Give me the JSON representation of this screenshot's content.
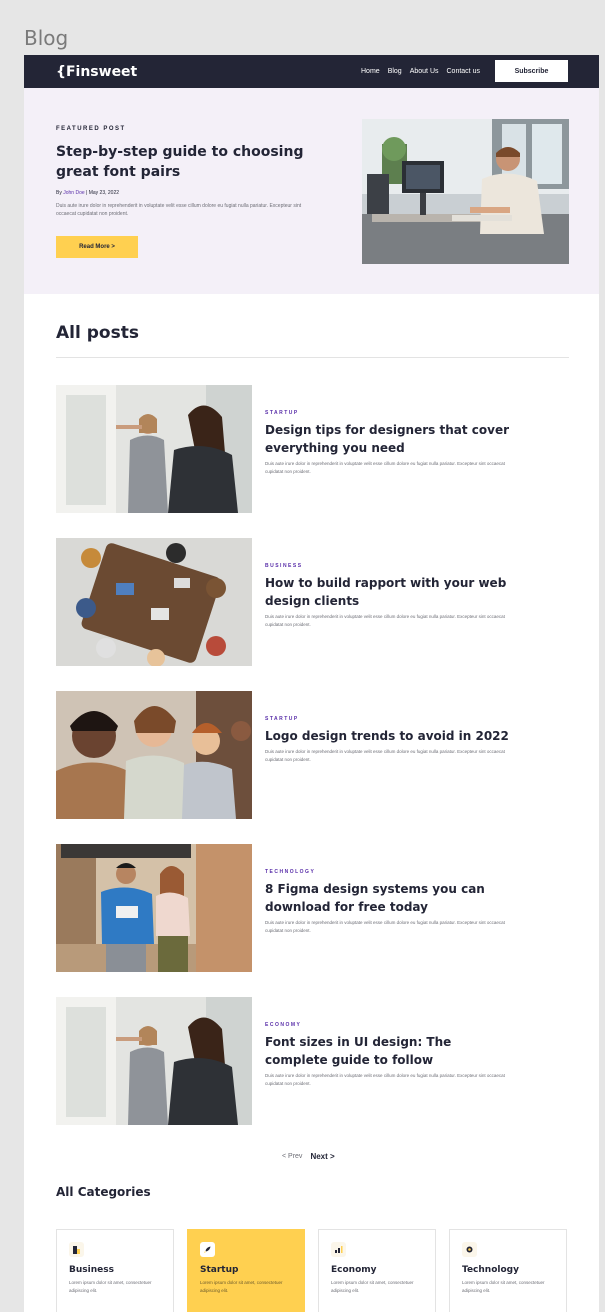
{
  "frame_label": "Blog",
  "nav": {
    "logo": "{Finsweet",
    "links": [
      "Home",
      "Blog",
      "About Us",
      "Contact us"
    ],
    "subscribe_label": "Subscribe"
  },
  "featured": {
    "label": "FEATURED POST",
    "title": "Step-by-step guide to choosing great font pairs",
    "meta_prefix": "By ",
    "author": "John Doe",
    "meta_separator": " | ",
    "date": "May 23, 2022",
    "description": "Duis aute irure dolor in reprehenderit in voluptate velit esse cillum dolore eu fugiat nulla pariatur. Excepteur sint occaecat cupidatat non proident.",
    "button_label": "Read More >"
  },
  "all_posts": {
    "title": "All posts",
    "posts": [
      {
        "category": "STARTUP",
        "title": "Design tips for designers that cover everything you need",
        "description": "Duis aute irure dolor in reprehenderit in voluptate velit esse cillum dolore eu fugiat nulla pariatur. Excepteur sint occaecat cupidatat non proident."
      },
      {
        "category": "BUSINESS",
        "title": "How to build rapport with your web design clients",
        "description": "Duis aute irure dolor in reprehenderit in voluptate velit esse cillum dolore eu fugiat nulla pariatur. Excepteur sint occaecat cupidatat non proident."
      },
      {
        "category": "STARTUP",
        "title": "Logo design trends to avoid in 2022",
        "description": "Duis aute irure dolor in reprehenderit in voluptate velit esse cillum dolore eu fugiat nulla pariatur. Excepteur sint occaecat cupidatat non proident."
      },
      {
        "category": "TECHNOLOGY",
        "title": "8 Figma design systems you can download for free today",
        "description": "Duis aute irure dolor in reprehenderit in voluptate velit esse cillum dolore eu fugiat nulla pariatur. Excepteur sint occaecat cupidatat non proident."
      },
      {
        "category": "ECONOMY",
        "title": "Font sizes in UI design: The complete guide to follow",
        "description": "Duis aute irure dolor in reprehenderit in voluptate velit esse cillum dolore eu fugiat nulla pariatur. Excepteur sint occaecat cupidatat non proident."
      }
    ]
  },
  "pagination": {
    "prev_label": "< Prev",
    "next_label": "Next >"
  },
  "categories": {
    "title": "All Categories",
    "items": [
      {
        "name": "Business",
        "description": "Lorem ipsum dolor sit amet, consectetuer adipiscing elit.",
        "icon": "building-icon"
      },
      {
        "name": "Startup",
        "description": "Lorem ipsum dolor sit amet, consectetuer adipiscing elit.",
        "icon": "rocket-icon"
      },
      {
        "name": "Economy",
        "description": "Lorem ipsum dolor sit amet, consectetuer adipiscing elit.",
        "icon": "bar-chart-icon"
      },
      {
        "name": "Technology",
        "description": "Lorem ipsum dolor sit amet, consectetuer adipiscing elit.",
        "icon": "cpu-icon"
      }
    ]
  },
  "colors": {
    "dark": "#232536",
    "accent_yellow": "#ffd050",
    "accent_purple": "#592ea9",
    "hero_bg": "#f4f0f8",
    "muted_text": "#6d6e76"
  }
}
